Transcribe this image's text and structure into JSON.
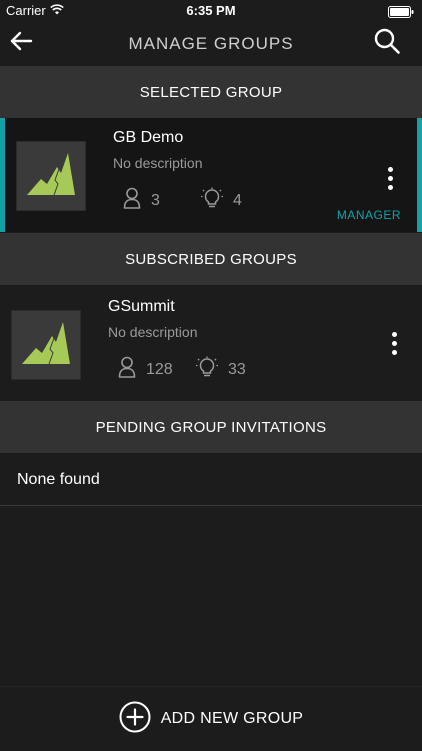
{
  "status_bar": {
    "carrier": "Carrier",
    "time": "6:35 PM",
    "wifi_icon": "wifi-icon",
    "battery_icon": "battery-icon"
  },
  "nav": {
    "title": "MANAGE GROUPS",
    "back_icon": "back-arrow-icon",
    "search_icon": "search-icon"
  },
  "sections": {
    "selected": "SELECTED GROUP",
    "subscribed": "SUBSCRIBED GROUPS",
    "pending": "PENDING GROUP INVITATIONS"
  },
  "selected_group": {
    "name": "GB Demo",
    "description": "No description",
    "members": "3",
    "ideas": "4",
    "role": "MANAGER"
  },
  "subscribed_groups": [
    {
      "name": "GSummit",
      "description": "No description",
      "members": "128",
      "ideas": "33"
    }
  ],
  "pending": {
    "empty_text": "None found"
  },
  "bottom": {
    "add_label": "ADD NEW GROUP",
    "add_icon": "plus-circle-icon"
  },
  "colors": {
    "background": "#1c1c1c",
    "header": "#333333",
    "accent": "#16a0a6",
    "logo": "#a7c957",
    "muted_text": "#9a9a9a"
  }
}
